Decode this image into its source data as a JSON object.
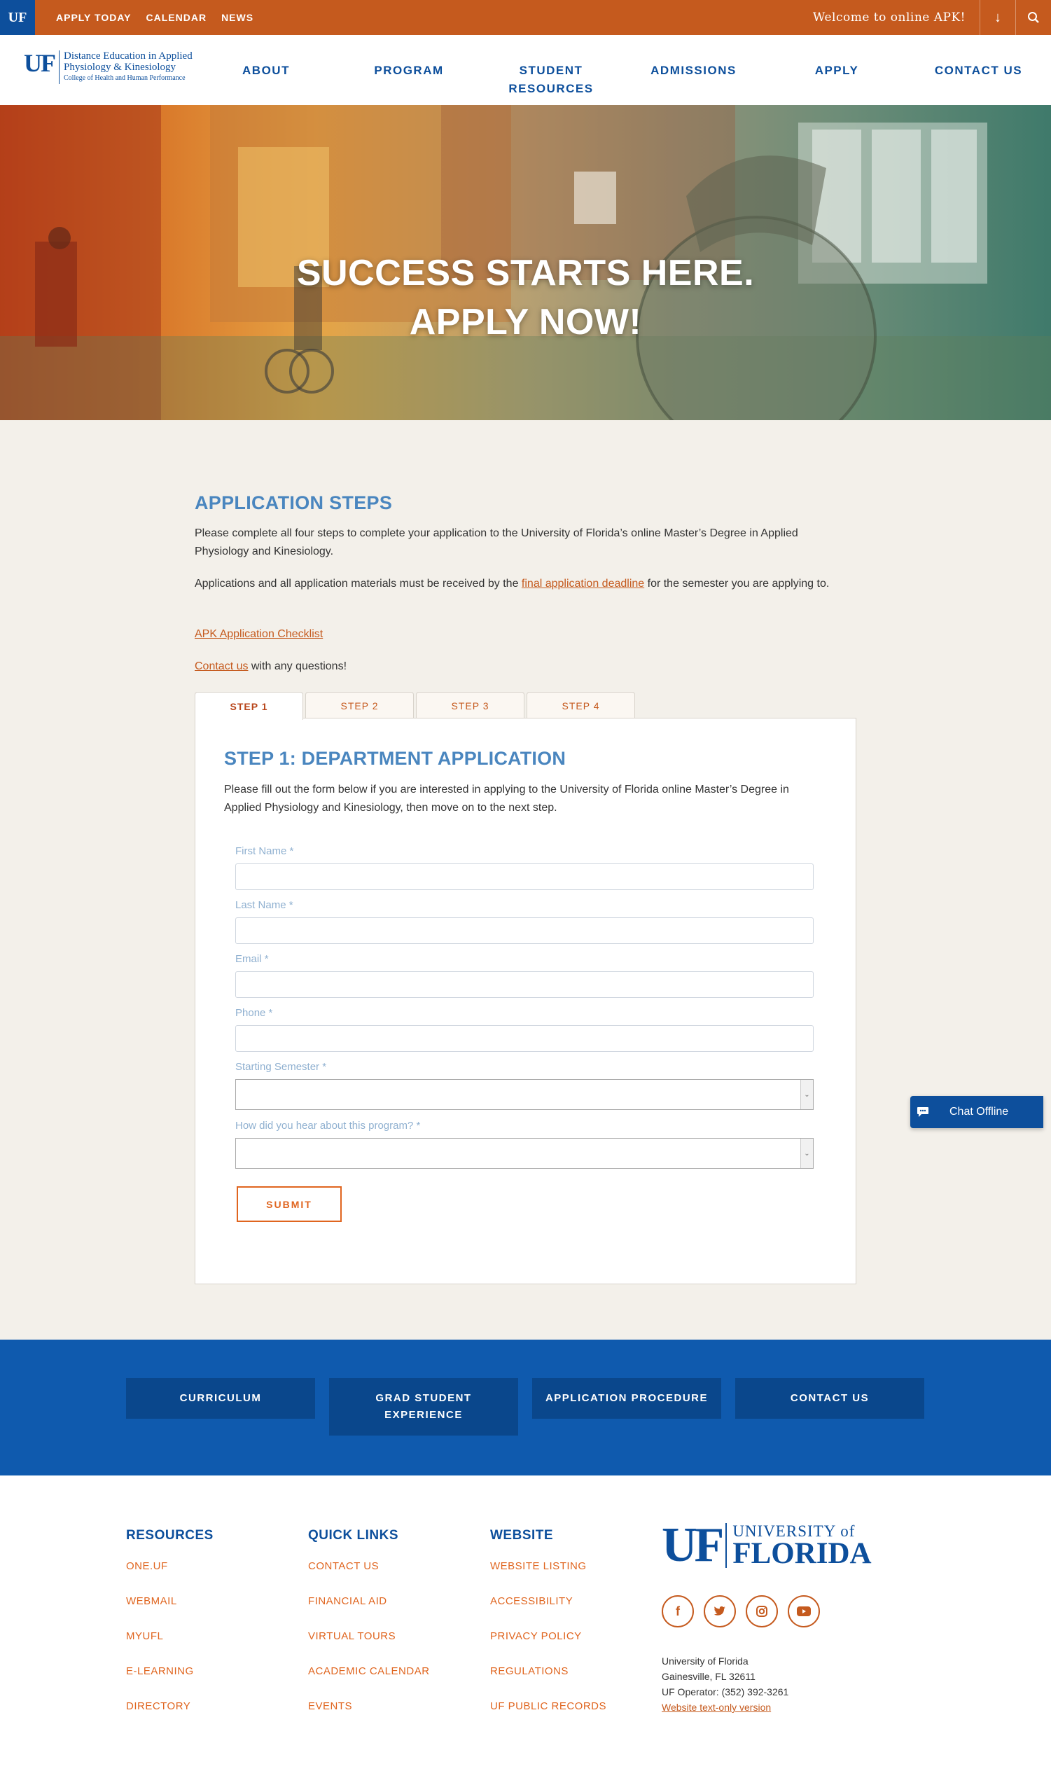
{
  "topbar": {
    "badge": "UF",
    "links": [
      "APPLY TODAY",
      "CALENDAR",
      "NEWS"
    ],
    "welcome": "Welcome to online APK!",
    "down_icon": "arrow-down-icon",
    "search_icon": "search-icon"
  },
  "header": {
    "logo": {
      "mark": "UF",
      "line1": "Distance Education in Applied",
      "line2": "Physiology & Kinesiology",
      "line3": "College of Health and Human Performance"
    },
    "nav": [
      {
        "label": "ABOUT"
      },
      {
        "label": "PROGRAM"
      },
      {
        "label": "STUDENT RESOURCES"
      },
      {
        "label": "ADMISSIONS"
      },
      {
        "label": "APPLY"
      },
      {
        "label": "CONTACT US"
      }
    ]
  },
  "hero": {
    "line1": "SUCCESS STARTS HERE.",
    "line2": "APPLY NOW!"
  },
  "main": {
    "heading": "APPLICATION STEPS",
    "intro": "Please complete all four steps to complete your application to the University of Florida’s online Master’s Degree in Applied Physiology and Kinesiology.",
    "deadline_pre": "Applications and all application materials must be received by the ",
    "deadline_link": "final application deadline",
    "deadline_post": " for the semester you are applying to.",
    "checklist_link": "APK Application Checklist",
    "contact_link": "Contact us",
    "contact_post": " with any questions!",
    "tabs": [
      "STEP 1",
      "STEP 2",
      "STEP 3",
      "STEP 4"
    ],
    "active_tab": "STEP 1",
    "panel": {
      "title": "STEP 1: DEPARTMENT APPLICATION",
      "description": "Please fill out the form below if you are interested in applying to the University of Florida online Master’s Degree in Applied Physiology and Kinesiology, then move on to the next step.",
      "fields": {
        "first_name": {
          "label": "First Name",
          "required": "*",
          "value": ""
        },
        "last_name": {
          "label": "Last Name",
          "required": "*",
          "value": ""
        },
        "email": {
          "label": "Email",
          "required": "*",
          "value": ""
        },
        "phone": {
          "label": "Phone",
          "required": "*",
          "value": ""
        },
        "semester": {
          "label": "Starting Semester",
          "required": "*",
          "value": ""
        },
        "hear": {
          "label": "How did you hear about this program?",
          "required": "*",
          "value": ""
        }
      },
      "submit": "SUBMIT"
    }
  },
  "chat": {
    "label": "Chat Offline",
    "icon": "chat-bubble-icon"
  },
  "band": {
    "buttons": [
      "CURRICULUM",
      "GRAD STUDENT EXPERIENCE",
      "APPLICATION PROCEDURE",
      "CONTACT US"
    ]
  },
  "footer": {
    "columns": [
      {
        "title": "RESOURCES",
        "links": [
          "ONE.UF",
          "WEBMAIL",
          "MYUFL",
          "E-LEARNING",
          "DIRECTORY"
        ]
      },
      {
        "title": "QUICK LINKS",
        "links": [
          "CONTACT US",
          "FINANCIAL AID",
          "VIRTUAL TOURS",
          "ACADEMIC CALENDAR",
          "EVENTS"
        ]
      },
      {
        "title": "WEBSITE",
        "links": [
          "WEBSITE LISTING",
          "ACCESSIBILITY",
          "PRIVACY POLICY",
          "REGULATIONS",
          "UF PUBLIC RECORDS"
        ]
      }
    ],
    "uf_logo": {
      "mark": "UF",
      "top": "UNIVERSITY of",
      "bottom": "FLORIDA"
    },
    "social": [
      {
        "icon": "facebook-icon",
        "glyph": "f"
      },
      {
        "icon": "twitter-icon",
        "glyph": "t"
      },
      {
        "icon": "instagram-icon",
        "glyph": "◎"
      },
      {
        "icon": "youtube-icon",
        "glyph": "▶"
      }
    ],
    "address": {
      "line1": "University of Florida",
      "line2": "Gainesville, FL 32611",
      "line3": "UF Operator: (352) 392-3261",
      "text_only_link": "Website text-only version"
    }
  },
  "colors": {
    "orange": "#c55a1e",
    "uf_blue": "#0d4f9c",
    "heading_blue": "#4a86bf",
    "band_blue": "#0f5aae"
  }
}
